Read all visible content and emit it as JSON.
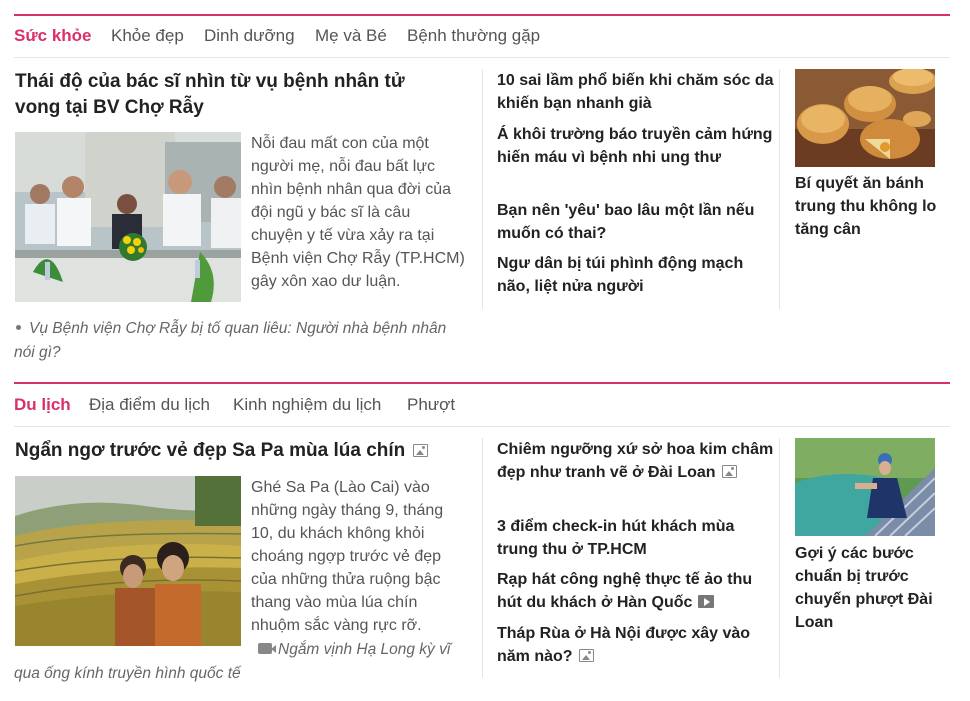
{
  "sections": [
    {
      "category": "Sức khỏe",
      "subnav": [
        "Khỏe đẹp",
        "Dinh dưỡng",
        "Mẹ và Bé",
        "Bệnh thường gặp"
      ],
      "lead": {
        "title": "Thái độ của bác sĩ nhìn từ vụ bệnh nhân tử vong tại BV Chợ Rẫy",
        "sapo": "Nỗi đau mất con của một người mẹ, nỗi đau bất lực nhìn bệnh nhân qua đời của đội ngũ y bác sĩ là câu chuyện y tế vừa xảy ra tại Bệnh viện Chợ Rẫy (TP.HCM) gây xôn xao dư luận.",
        "related": "Vụ Bệnh viện Chợ Rẫy bị tố quan liêu: Người nhà bệnh nhân nói gì?",
        "image_alt": "doctors-press-conference-photo"
      },
      "middle": [
        {
          "title": "10 sai lầm phổ biến khi chăm sóc da khiến bạn nhanh già"
        },
        {
          "title": "Á khôi trường báo truyền cảm hứng hiến máu vì bệnh nhi ung thư"
        },
        {
          "title": "Bạn nên 'yêu' bao lâu một lần nếu muốn có thai?"
        },
        {
          "title": "Ngư dân bị túi phình động mạch não, liệt nửa người"
        }
      ],
      "right": {
        "title": "Bí quyết ăn bánh trung thu không lo tăng cân",
        "image_alt": "mooncakes-photo"
      }
    },
    {
      "category": "Du lịch",
      "subnav": [
        "Địa điểm du lịch",
        "Kinh nghiệm du lịch",
        "Phượt"
      ],
      "lead": {
        "title": "Ngẩn ngơ trước vẻ đẹp Sa Pa mùa lúa chín",
        "sapo": "Ghé Sa Pa (Lào Cai) vào những ngày tháng 9, tháng 10, du khách không khỏi choáng ngợp trước vẻ đẹp của những thửa ruộng bậc thang vào mùa lúa chín nhuộm sắc vàng rực rỡ.",
        "related": "Ngắm vịnh Hạ Long kỳ vĩ qua ống kính truyền hình quốc tế",
        "image_alt": "sapa-rice-terraces-photo"
      },
      "middle": [
        {
          "title": "Chiêm ngưỡng xứ sở hoa kim châm đẹp như tranh vẽ ở Đài Loan",
          "icon": "photo-icon"
        },
        {
          "title": "3 điểm check-in hút khách mùa trung thu ở TP.HCM"
        },
        {
          "title": "Rạp hát công nghệ thực tế ảo thu hút du khách ở Hàn Quốc",
          "icon": "video-icon"
        },
        {
          "title": "Tháp Rùa ở Hà Nội được xây vào năm nào?",
          "icon": "photo-icon"
        }
      ],
      "right": {
        "title": "Gợi ý các bước chuẩn bị trước chuyến phượt Đài Loan",
        "image_alt": "taiwan-boardwalk-photo"
      }
    }
  ],
  "colors": {
    "accent": "#d9306b",
    "text": "#222222",
    "muted": "#555555",
    "divider": "#e5e5e5"
  }
}
